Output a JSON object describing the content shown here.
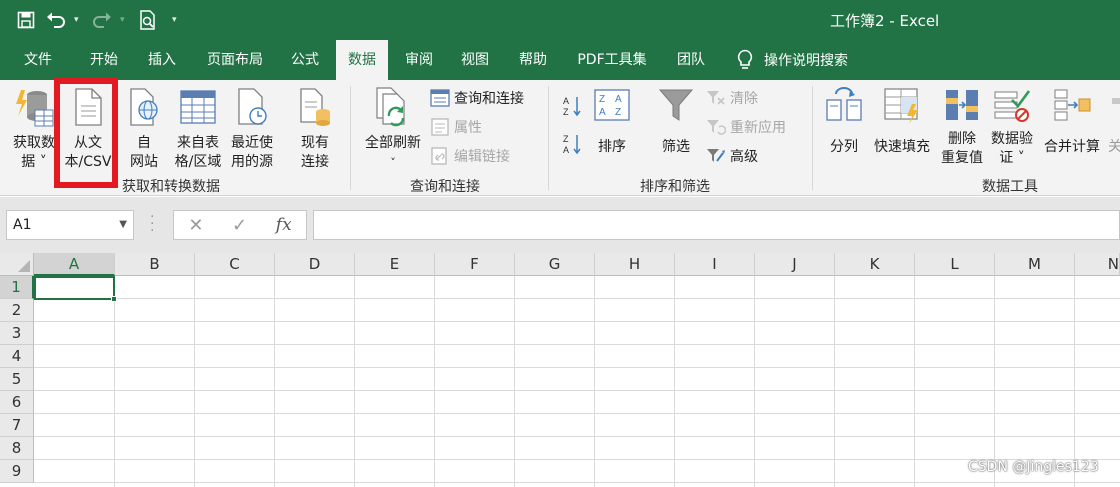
{
  "window": {
    "title": "工作簿2 - Excel"
  },
  "tabs": [
    "文件",
    "开始",
    "插入",
    "页面布局",
    "公式",
    "数据",
    "审阅",
    "视图",
    "帮助",
    "PDF工具集",
    "团队"
  ],
  "active_tab": "数据",
  "tell_me": "操作说明搜索",
  "ribbon": {
    "get_transform": {
      "group_name": "获取和转换数据",
      "get_data": {
        "line1": "获取数",
        "line2": "据 ˅"
      },
      "from_text_csv": {
        "line1": "从文",
        "line2": "本/CSV"
      },
      "from_web": {
        "line1": "自",
        "line2": "网站"
      },
      "from_table": {
        "line1": "来自表",
        "line2": "格/区域"
      },
      "recent_sources": {
        "line1": "最近使",
        "line2": "用的源"
      },
      "existing_connections": {
        "line1": "现有",
        "line2": "连接"
      }
    },
    "queries_connections": {
      "group_name": "查询和连接",
      "refresh_all": {
        "line1": "全部刷新",
        "line2": "˅"
      },
      "queries_and_connections": "查询和连接",
      "properties": "属性",
      "edit_links": "编辑链接"
    },
    "sort_filter": {
      "group_name": "排序和筛选",
      "sort": "排序",
      "filter": "筛选",
      "clear": "清除",
      "reapply": "重新应用",
      "advanced": "高级"
    },
    "data_tools": {
      "group_name": "数据工具",
      "text_to_columns": "分列",
      "flash_fill": "快速填充",
      "remove_duplicates": {
        "line1": "删除",
        "line2": "重复值"
      },
      "data_validation": {
        "line1": "数据验",
        "line2": "证 ˅"
      },
      "consolidate": "合并计算",
      "relationships": "关"
    }
  },
  "formula_bar": {
    "name_box": "A1",
    "fx": "fx",
    "value": ""
  },
  "grid": {
    "columns": [
      "A",
      "B",
      "C",
      "D",
      "E",
      "F",
      "G",
      "H",
      "I",
      "J",
      "K",
      "L",
      "M",
      "N"
    ],
    "rows": [
      "1",
      "2",
      "3",
      "4",
      "5",
      "6",
      "7",
      "8",
      "9"
    ],
    "active_cell": "A1"
  },
  "watermark": "CSDN @Jingles123",
  "colors": {
    "excel_green": "#217346",
    "highlight_red": "#e21b23"
  }
}
